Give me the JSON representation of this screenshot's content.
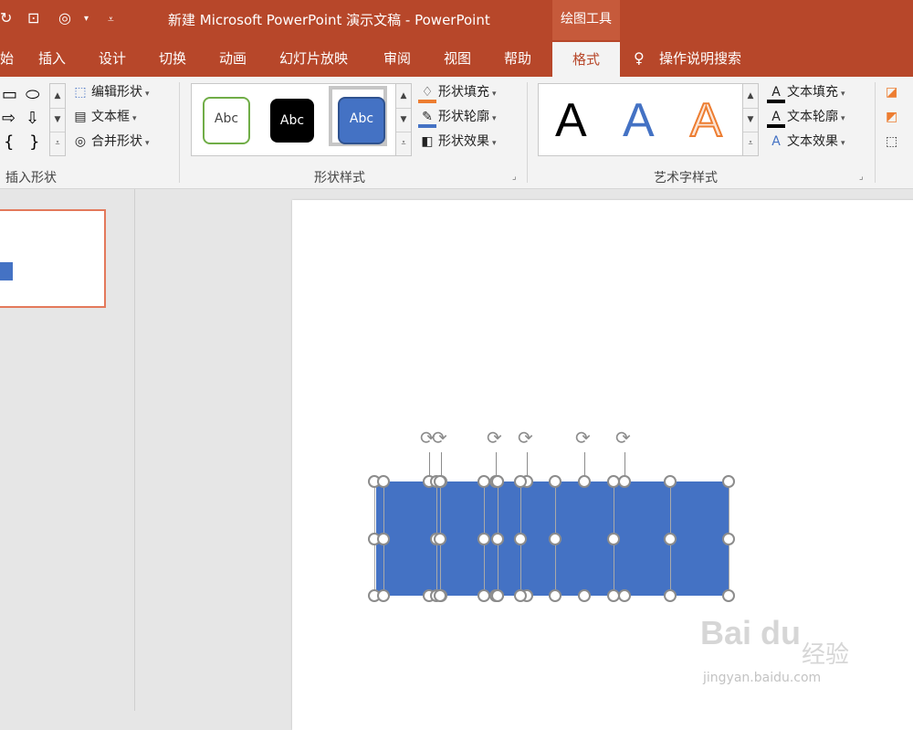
{
  "window": {
    "title": "新建 Microsoft PowerPoint 演示文稿  -  PowerPoint",
    "context_title": "绘图工具",
    "qa_icons": [
      "redo-icon",
      "present-icon",
      "touch-mode-icon",
      "customize-icon"
    ]
  },
  "tabs": [
    {
      "label": "始"
    },
    {
      "label": "插入"
    },
    {
      "label": "设计"
    },
    {
      "label": "切换"
    },
    {
      "label": "动画"
    },
    {
      "label": "幻灯片放映"
    },
    {
      "label": "审阅"
    },
    {
      "label": "视图"
    },
    {
      "label": "帮助"
    },
    {
      "label": "格式",
      "active": true
    },
    {
      "label": "操作说明搜索"
    }
  ],
  "groups": {
    "insert_shapes": {
      "label": "插入形状",
      "edit_shape": "编辑形状",
      "text_box": "文本框",
      "merge_shapes": "合并形状"
    },
    "shape_styles": {
      "label": "形状样式",
      "styles": [
        "Abc",
        "Abc",
        "Abc"
      ],
      "fill": "形状填充",
      "outline": "形状轮廓",
      "effects": "形状效果"
    },
    "wordart": {
      "label": "艺术字样式",
      "letters": [
        "A",
        "A",
        "A"
      ],
      "text_fill": "文本填充",
      "text_outline": "文本轮廓",
      "text_effects": "文本效果"
    }
  },
  "colors": {
    "brand": "#b7472a",
    "shape_fill": "#4472c4",
    "selection_thumb": "#e3795b"
  },
  "watermark": {
    "logo": "Bai du",
    "cn": "经验",
    "url": "jingyan.baidu.com"
  }
}
